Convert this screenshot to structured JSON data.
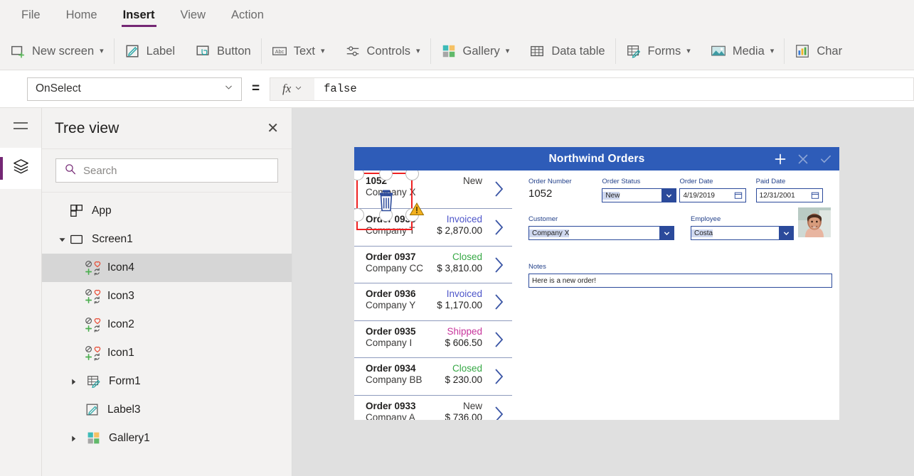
{
  "menu": {
    "items": [
      {
        "label": "File",
        "active": false
      },
      {
        "label": "Home",
        "active": false
      },
      {
        "label": "Insert",
        "active": true
      },
      {
        "label": "View",
        "active": false
      },
      {
        "label": "Action",
        "active": false
      }
    ]
  },
  "ribbon": {
    "items": [
      {
        "label": "New screen",
        "icon": "new-screen-icon",
        "chevron": true
      },
      {
        "label": "Label",
        "icon": "label-icon",
        "chevron": false
      },
      {
        "label": "Button",
        "icon": "button-icon",
        "chevron": false
      },
      {
        "label": "Text",
        "icon": "text-abc-icon",
        "chevron": true
      },
      {
        "label": "Controls",
        "icon": "controls-sliders-icon",
        "chevron": true
      },
      {
        "label": "Gallery",
        "icon": "gallery-grid-icon",
        "chevron": true
      },
      {
        "label": "Data table",
        "icon": "data-table-icon",
        "chevron": false
      },
      {
        "label": "Forms",
        "icon": "forms-icon",
        "chevron": true
      },
      {
        "label": "Media",
        "icon": "media-image-icon",
        "chevron": true
      },
      {
        "label": "Char",
        "icon": "charts-icon",
        "chevron": false
      }
    ]
  },
  "formula_bar": {
    "property": "OnSelect",
    "equals": "=",
    "fx_label": "fx",
    "formula": "false"
  },
  "rail": {
    "hamburger": "hamburger-icon",
    "active_tab": "tree-view-layers-icon"
  },
  "treeview": {
    "title": "Tree view",
    "close": "✕",
    "search_placeholder": "Search",
    "search_value": "",
    "items": [
      {
        "label": "App",
        "icon": "app-icon",
        "depth": 1,
        "arrow": "",
        "selected": false
      },
      {
        "label": "Screen1",
        "icon": "screen-icon",
        "depth": 1,
        "arrow": "▾",
        "selected": false
      },
      {
        "label": "Icon4",
        "icon": "icon-set-icon",
        "depth": 2,
        "arrow": "",
        "selected": true
      },
      {
        "label": "Icon3",
        "icon": "icon-set-icon",
        "depth": 2,
        "arrow": "",
        "selected": false
      },
      {
        "label": "Icon2",
        "icon": "icon-set-icon",
        "depth": 2,
        "arrow": "",
        "selected": false
      },
      {
        "label": "Icon1",
        "icon": "icon-set-icon",
        "depth": 2,
        "arrow": "",
        "selected": false
      },
      {
        "label": "Form1",
        "icon": "forms-icon",
        "depth": 2,
        "arrow": "▸",
        "selected": false
      },
      {
        "label": "Label3",
        "icon": "label-icon",
        "depth": 2,
        "arrow": "",
        "selected": false
      },
      {
        "label": "Gallery1",
        "icon": "gallery-grid-icon",
        "depth": 2,
        "arrow": "▸",
        "selected": false
      }
    ]
  },
  "app_preview": {
    "header": {
      "title": "Northwind Orders",
      "actions": [
        "add-icon",
        "cancel-icon",
        "confirm-icon"
      ]
    },
    "gallery": {
      "rows": [
        {
          "order": "1052",
          "company": "Company X",
          "status": "New",
          "amount": "",
          "status_color": "#3b3a39",
          "first": true
        },
        {
          "order": "Order 0938",
          "company": "Company T",
          "status": "Invoiced",
          "amount": "$ 2,870.00",
          "status_color": "#4d55c9"
        },
        {
          "order": "Order 0937",
          "company": "Company CC",
          "status": "Closed",
          "amount": "$ 3,810.00",
          "status_color": "#36a845"
        },
        {
          "order": "Order 0936",
          "company": "Company Y",
          "status": "Invoiced",
          "amount": "$ 1,170.00",
          "status_color": "#4d55c9"
        },
        {
          "order": "Order 0935",
          "company": "Company I",
          "status": "Shipped",
          "amount": "$ 606.50",
          "status_color": "#c8359c"
        },
        {
          "order": "Order 0934",
          "company": "Company BB",
          "status": "Closed",
          "amount": "$ 230.00",
          "status_color": "#36a845"
        },
        {
          "order": "Order 0933",
          "company": "Company A",
          "status": "New",
          "amount": "$ 736.00",
          "status_color": "#3b3a39"
        }
      ]
    },
    "form": {
      "order_number": {
        "label": "Order Number",
        "value": "1052"
      },
      "order_status": {
        "label": "Order Status",
        "value": "New"
      },
      "order_date": {
        "label": "Order Date",
        "value": "4/19/2019"
      },
      "paid_date": {
        "label": "Paid Date",
        "value": "12/31/2001"
      },
      "customer": {
        "label": "Customer",
        "value": "Company X"
      },
      "employee": {
        "label": "Employee",
        "value": "Costa"
      },
      "notes": {
        "label": "Notes",
        "value": "Here is a new order!"
      },
      "photo": "employee-photo"
    },
    "selection": {
      "selected_control": "trash-icon",
      "warning": "warning-triangle-icon"
    }
  },
  "colors": {
    "accent_purple": "#742774",
    "app_blue": "#2e5cb8",
    "field_blue": "#2b4a9b",
    "selection_red": "#ef2222"
  }
}
